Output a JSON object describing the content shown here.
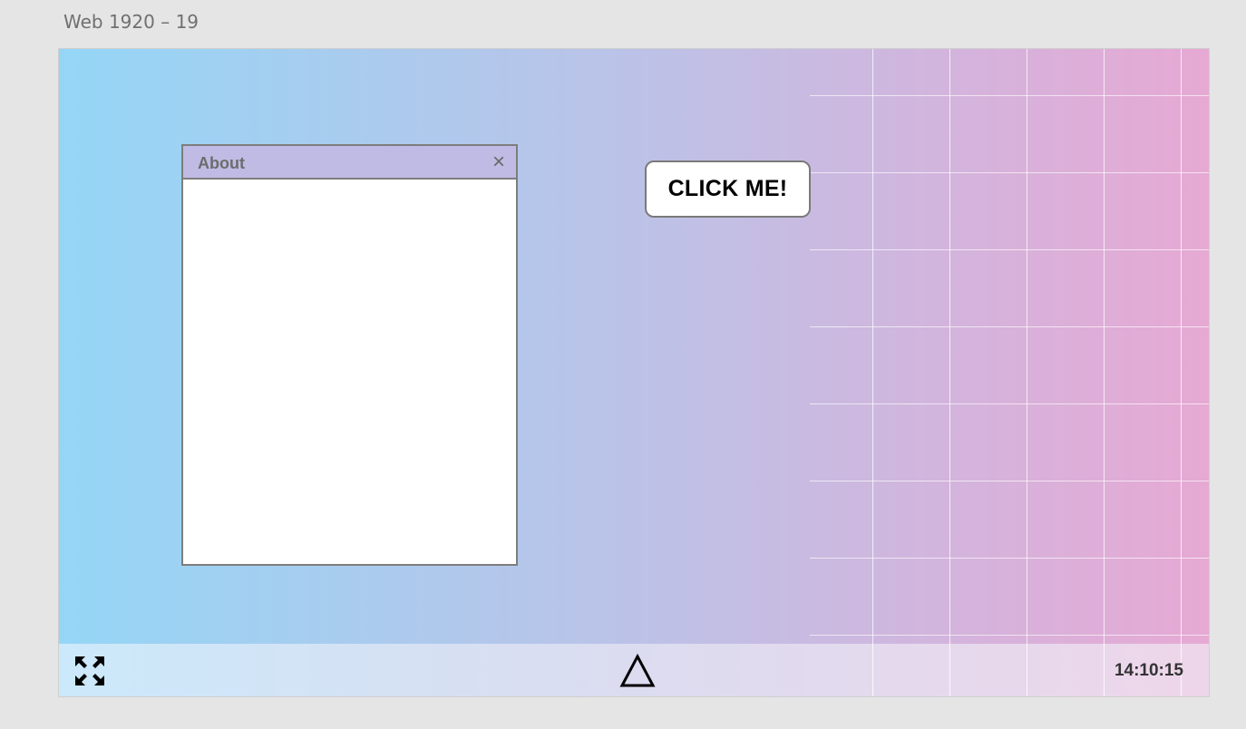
{
  "artboard": {
    "label": "Web 1920 – 19"
  },
  "window": {
    "title": "About",
    "close_symbol": "×"
  },
  "desktop": {
    "click_button_label": "CLICK ME!"
  },
  "taskbar": {
    "fullscreen_icon": "expand-arrows-icon",
    "start_icon": "triangle-icon",
    "clock": "14:10:15"
  },
  "colors": {
    "gradient_left": "#95d6f6",
    "gradient_mid": "#bcc2e7",
    "gradient_right": "#e6a9d4",
    "titlebar": "#c0bbe4",
    "border": "#7d7d7d"
  }
}
